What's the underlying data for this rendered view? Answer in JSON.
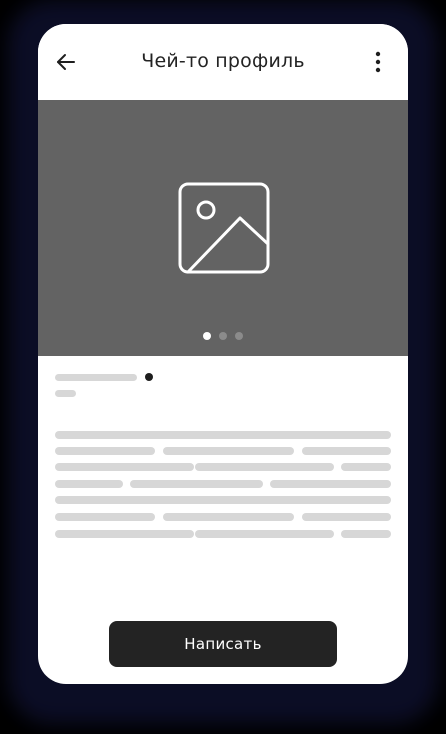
{
  "header": {
    "title": "Чей-то профиль",
    "back_icon": "arrow-left-icon",
    "menu_icon": "more-vertical-icon"
  },
  "gallery": {
    "placeholder_icon": "image-placeholder-icon",
    "page_count": 3,
    "current_page": 1
  },
  "actions": {
    "write_label": "Написать"
  },
  "colors": {
    "hero_bg": "#636363",
    "button_bg": "#232323",
    "skeleton": "#d7d7d7"
  }
}
